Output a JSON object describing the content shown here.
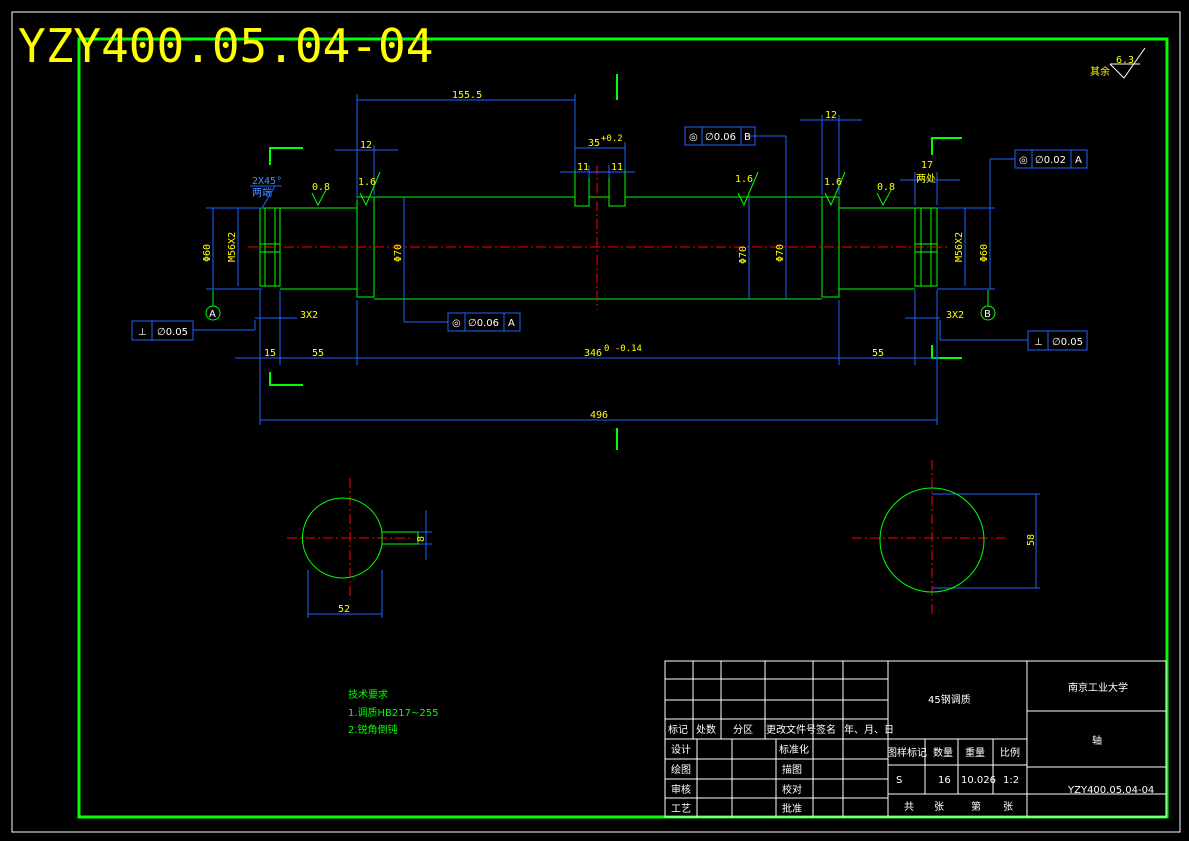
{
  "drawing_number_title": "YZY400.05.04-04",
  "colors": {
    "background": "#000000",
    "frame": "#00ff00",
    "part_outline": "#00ff00",
    "dimension": "#1e64ff",
    "centerline": "#ff0000",
    "text_yellow": "#ffff00",
    "text_white": "#ffffff"
  },
  "roughness_general": {
    "label": "其余",
    "value": "6.3"
  },
  "dimensions": {
    "d155": "155.5",
    "d12a": "12",
    "d12b": "12",
    "key_w": "35",
    "key_tol": "+0.2",
    "d11a": "11",
    "d11b": "11",
    "d17": "17",
    "chamfer": "2X45°",
    "chamfer_note": "两端",
    "both_ends": "两处",
    "phi60": "Φ60",
    "m56a": "M56X2",
    "phi70a": "Φ70",
    "phi70b": "Φ70",
    "phi70c": "Φ70",
    "m56b": "M56X2",
    "phi60b": "Φ60",
    "d3x2a": "3X2",
    "d3x2b": "3X2",
    "d15": "15",
    "d55a": "55",
    "d346": "346",
    "d346_tol": "0\n-0.14",
    "d55b": "55",
    "d496": "496",
    "sec_a_width": "52",
    "sec_a_key": "8",
    "sec_b_dia": "58"
  },
  "roughness": {
    "r1": "0.8",
    "r2": "1.6",
    "r3": "1.6",
    "r4": "1.6",
    "r5": "0.8"
  },
  "tolerance_frames": {
    "f1": {
      "sym": "◎",
      "val": "∅0.06",
      "ref": "B"
    },
    "f2": {
      "sym": "◎",
      "val": "∅0.02",
      "ref": "A"
    },
    "f3": {
      "sym": "◎",
      "val": "∅0.06",
      "ref": "A"
    },
    "f4": {
      "sym": "⊥",
      "val": "∅0.05"
    },
    "f5": {
      "sym": "⊥",
      "val": "∅0.05"
    }
  },
  "datum": {
    "a": "A",
    "b": "B"
  },
  "tech_requirements": {
    "title": "技术要求",
    "items": [
      "1.调质HB217~255",
      "2.锐角倒钝"
    ]
  },
  "title_block": {
    "col_headers": [
      "标记",
      "处数",
      "分区",
      "更改文件号",
      "签名",
      "年、月、日"
    ],
    "roles": [
      "设计",
      "绘图",
      "审核",
      "工艺"
    ],
    "role_right": [
      "标准化",
      "描图",
      "校对",
      "批准"
    ],
    "material": "45钢调质",
    "institution": "南京工业大学",
    "part_name": "轴",
    "attr_headers": [
      "图样标记",
      "数量",
      "重量",
      "比例"
    ],
    "attr_values": [
      "S",
      "16",
      "10.026",
      "1:2"
    ],
    "sheet_total": "共",
    "sheet_unit1": "张",
    "sheet_no": "第",
    "sheet_unit2": "张",
    "drawing_no": "YZY400.05.04-04"
  }
}
